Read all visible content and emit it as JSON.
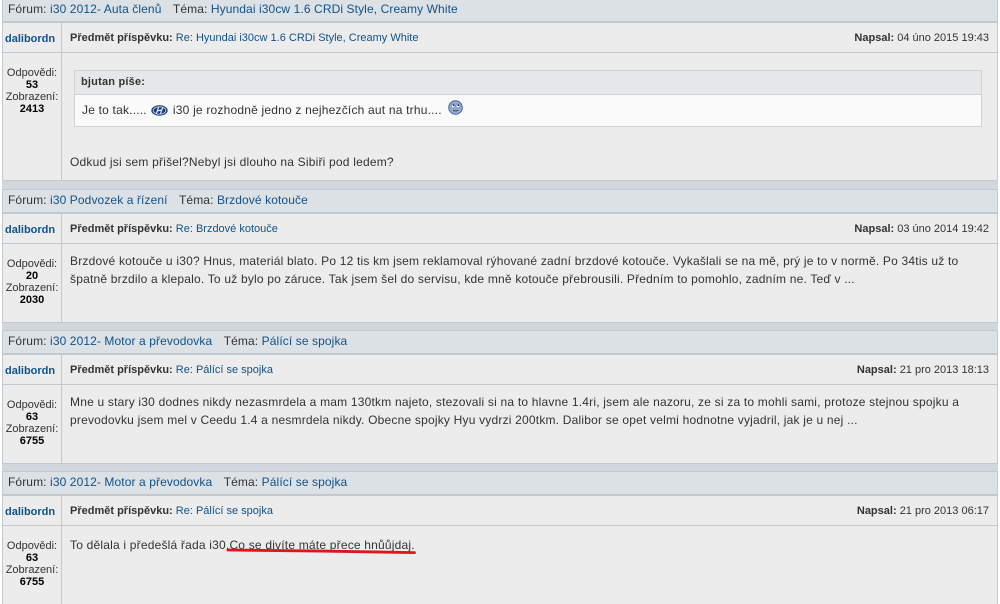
{
  "colors": {
    "link": "#105289",
    "header_row": "#dce1e5",
    "row": "#ececec",
    "annotation": "#e0151b"
  },
  "results": [
    {
      "forum_label": "Fórum:",
      "forum": "i30 2012- Auta členů",
      "topic_label": "Téma:",
      "topic": "Hyundai i30cw 1.6 CRDi Style, Creamy White",
      "author": "dalibordn",
      "subject_label": "Předmět příspěvku:",
      "subject": "Re: Hyundai i30cw 1.6 CRDi Style, Creamy White",
      "posted_label": "Napsal:",
      "posted": "04 úno 2015 19:43",
      "replies_label": "Odpovědi:",
      "replies": "53",
      "views_label": "Zobrazení:",
      "views": "2413",
      "quote": {
        "author_label": "bjutan píše:",
        "text_before_icon": "Je to tak.....",
        "icon": "hyundai-logo-icon",
        "text_after_icon": "i30 je rozhodně jedno z nejhezčích aut na trhu....",
        "end_icon": "smiley-icon"
      },
      "text": "Odkud jsi sem přišel?Nebyl jsi dlouho na Sibiři pod ledem?"
    },
    {
      "forum_label": "Fórum:",
      "forum": "i30 Podvozek a řízení",
      "topic_label": "Téma:",
      "topic": "Brzdové kotouče",
      "author": "dalibordn",
      "subject_label": "Předmět příspěvku:",
      "subject": "Re: Brzdové kotouče",
      "posted_label": "Napsal:",
      "posted": "03 úno 2014 19:42",
      "replies_label": "Odpovědi:",
      "replies": "20",
      "views_label": "Zobrazení:",
      "views": "2030",
      "text": "Brzdové kotouče u i30? Hnus, materiál blato. Po 12 tis km jsem reklamoval rýhované zadní brzdové kotouče. Vykašlali se na mě, prý je to v normě. Po 34tis už to špatně brzdilo a klepalo. To už bylo po záruce. Tak jsem šel do servisu, kde mně kotouče přebrousili. Předním to pomohlo, zadním ne. Teď v ..."
    },
    {
      "forum_label": "Fórum:",
      "forum": "i30 2012- Motor a převodovka",
      "topic_label": "Téma:",
      "topic": "Pálící se spojka",
      "author": "dalibordn",
      "subject_label": "Předmět příspěvku:",
      "subject": "Re: Pálící se spojka",
      "posted_label": "Napsal:",
      "posted": "21 pro 2013 18:13",
      "replies_label": "Odpovědi:",
      "replies": "63",
      "views_label": "Zobrazení:",
      "views": "6755",
      "text": "Mne u stary i30 dodnes nikdy nezasmrdela a mam 130tkm najeto, stezovali si na to hlavne 1.4ri, jsem ale nazoru, ze si za to mohli sami, protoze stejnou spojku a prevodovku jsem mel v Ceedu 1.4 a nesmrdela nikdy. Obecne spojky Hyu vydrzi 200tkm. Dalibor se opet velmi hodnotne vyjadril, jak je u nej ..."
    },
    {
      "forum_label": "Fórum:",
      "forum": "i30 2012- Motor a převodovka",
      "topic_label": "Téma:",
      "topic": "Pálící se spojka",
      "author": "dalibordn",
      "subject_label": "Předmět příspěvku:",
      "subject": "Re: Pálící se spojka",
      "posted_label": "Napsal:",
      "posted": "21 pro 2013 06:17",
      "replies_label": "Odpovědi:",
      "replies": "63",
      "views_label": "Zobrazení:",
      "views": "6755",
      "text": "To dělala i předešlá řada i30.",
      "underlined_text": "Co se divíte máte přece hnůůjdaj."
    }
  ]
}
